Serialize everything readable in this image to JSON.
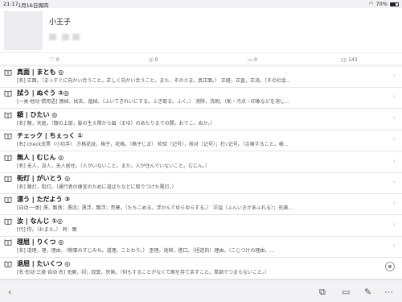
{
  "status_bar": {
    "time": "21:17",
    "date": "1月16日周四",
    "battery": "70%"
  },
  "profile": {
    "name": "小王子"
  },
  "stats": [
    {
      "icon": "heart-icon",
      "value": "0"
    },
    {
      "icon": "eye-icon",
      "value": "0"
    },
    {
      "icon": "folder-icon",
      "value": "0"
    },
    {
      "icon": "book-icon",
      "value": "143"
    }
  ],
  "words": [
    {
      "headword": "真面 | まとも ◎",
      "meta": "[名] 正面。（まっすぐに向かい合うこと。正しく向かい合うこと。また、そのさま。真正面。） 正経，正直，正派。（その社会..."
    },
    {
      "headword": "拭う | ぬぐう ②◎",
      "meta": "[一类·他动·惯用语] 擦掉，拭去，揩掉。（ふいてきれいにする。ふき取る。ふく。） 消除，洗刷。（恥・汚点・印象などを消し..."
    },
    {
      "headword": "額 | ひたい ◎",
      "meta": "[名] 额，天庭。（顔の上部，髪の生え際から眉（まゆ）のあたりまでの間。おでこ。ぬか。）"
    },
    {
      "headword": "チェック | ちぇっく ①",
      "meta": "[名] check支票（小切手） 方格花纹，格子，花格。（格子じま） 检验（记号），核对（记号）；打√记号。（点検すること。検..."
    },
    {
      "headword": "無人 | むじん ◎",
      "meta": "[名] 无人，没人，无人居住。（人がいないこと。また，人が住んでいないこと。むにん。）"
    },
    {
      "headword": "街灯 | がいとう ◎",
      "meta": "[名] 路灯，街灯。（通行者の便宜のために道ばたなどに取りつけた電灯。）"
    },
    {
      "headword": "漂う | ただよう ③",
      "meta": "[自动·一类] 漂，飘荡；漂流；漂浮，飘浮；荒寒。（たちこめる，浮かんでゆらゆらする。） 洋溢（ふんいきがあふれる）；充满..."
    },
    {
      "headword": "汝 | なんじ ①◎",
      "meta": "[代] 你。（おまえ。） 同：爾"
    },
    {
      "headword": "理屈 | りくつ ◎",
      "meta": "[名] 道理，理，理由，（物事のすじみち。道理。ことわり。） 歪理，诡辩，借口。（捏造的）理由。（こじつけの理由，..."
    },
    {
      "headword": "退屈 | たいくつ ◎",
      "meta": "[名·形动·三类·自动·名] 无聊，闷；寂寞，厌倦。（何もすることがなくて暇を持て余すこと。単調でつまらないこと。）"
    }
  ],
  "bottom_bar": [
    "back-icon",
    "move-folder-icon",
    "folder-icon",
    "edit-icon",
    "more-icon"
  ]
}
